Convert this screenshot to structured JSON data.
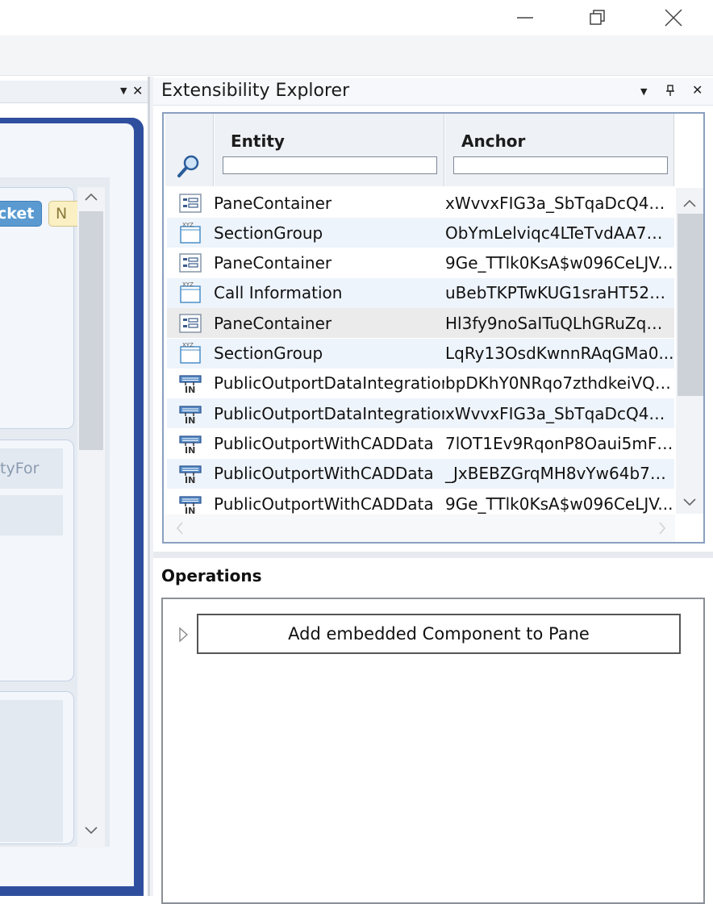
{
  "window": {
    "controls": [
      "minimize-icon",
      "restore-icon",
      "close-icon"
    ]
  },
  "left_pane": {
    "ticket_button": "cket",
    "n_button": "N",
    "field_text": "tyFor"
  },
  "explorer": {
    "title": "Extensibility Explorer",
    "columns": {
      "entity": "Entity",
      "anchor": "Anchor"
    },
    "rows": [
      {
        "icon": "pane-container-icon",
        "entity": "PaneContainer",
        "anchor": "xWvvxFIG3a_SbTqaDcQ4R(..."
      },
      {
        "icon": "section-group-icon",
        "entity": "SectionGroup",
        "anchor": "ObYmLelviqc4LTeTvdAA7W..."
      },
      {
        "icon": "pane-container-icon",
        "entity": "PaneContainer",
        "anchor": "9Ge_TTlk0KsA$w096CeLJV..."
      },
      {
        "icon": "section-group-icon",
        "entity": "Call Information",
        "anchor": "uBebTKPTwKUG1sraHT52H..."
      },
      {
        "icon": "pane-container-icon",
        "entity": "PaneContainer",
        "anchor": "Hl3fy9noSaITuQLhGRuZqW..."
      },
      {
        "icon": "section-group-icon",
        "entity": "SectionGroup",
        "anchor": "LqRy13OsdKwnnRAqGMa0..."
      },
      {
        "icon": "outport-icon",
        "entity": "PublicOutportDataIntegration",
        "anchor": "bpDKhY0NRqo7zthdkeiVQ(..."
      },
      {
        "icon": "outport-icon",
        "entity": "PublicOutportDataIntegration",
        "anchor": "xWvvxFIG3a_SbTqaDcQ4R(..."
      },
      {
        "icon": "outport-icon",
        "entity": "PublicOutportWithCADData",
        "anchor": "7lOT1Ev9RqonP8Oaui5mF\\..."
      },
      {
        "icon": "outport-icon",
        "entity": "PublicOutportWithCADData",
        "anchor": "_JxBEBZGrqMH8vYw64b7n..."
      },
      {
        "icon": "outport-icon",
        "entity": "PublicOutportWithCADData",
        "anchor": "9Ge_TTlk0KsA$w096CeLJV..."
      }
    ]
  },
  "operations": {
    "title": "Operations",
    "button_label": "Add embedded Component to Pane"
  },
  "colors": {
    "grid_border": "#8aa0c0",
    "row_alt": "#eef4fb",
    "row_selected": "#ebebeb",
    "left_frame": "#2f4f9e"
  }
}
